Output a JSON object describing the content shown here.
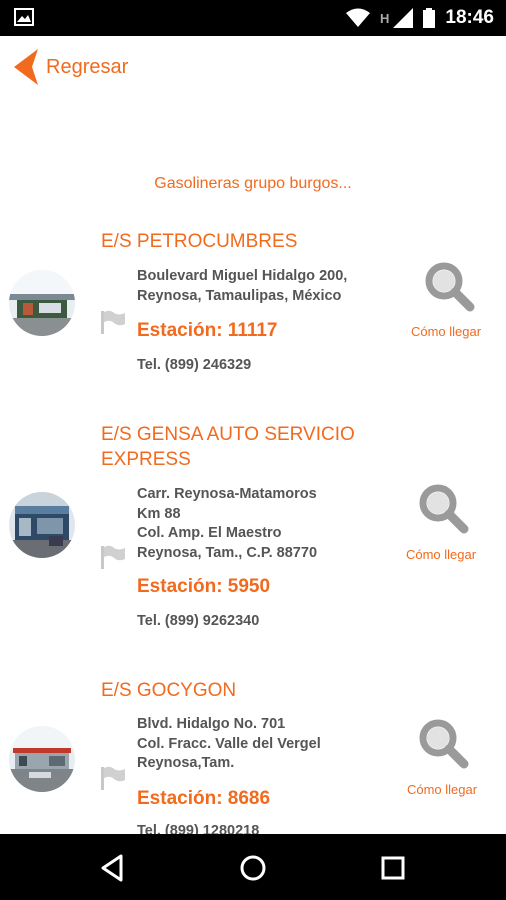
{
  "status_bar": {
    "time": "18:46",
    "network_letter": "H",
    "icons": [
      "photo-icon",
      "wifi-icon",
      "signal-icon",
      "battery-icon"
    ]
  },
  "header": {
    "back_label": "Regresar"
  },
  "subtitle": "Gasolineras grupo burgos...",
  "stations": [
    {
      "name": "E/S PETROCUMBRES",
      "address_lines": [
        "Boulevard Miguel Hidalgo 200,",
        "Reynosa, Tamaulipas, México"
      ],
      "station_label": "Estación: 11117",
      "tel": "Tel. (899) 246329",
      "directions_label": "Cómo llegar"
    },
    {
      "name": "E/S GENSA AUTO SERVICIO EXPRESS",
      "address_lines": [
        "Carr. Reynosa-Matamoros",
        "Km 88",
        "Col. Amp. El Maestro",
        "Reynosa, Tam., C.P. 88770"
      ],
      "station_label": "Estación: 5950",
      "tel": "Tel. (899) 9262340",
      "directions_label": "Cómo llegar"
    },
    {
      "name": "E/S GOCYGON",
      "address_lines": [
        "Blvd. Hidalgo No. 701",
        "Col. Fracc. Valle del Vergel",
        "Reynosa,Tam."
      ],
      "station_label": "Estación: 8686",
      "tel": "Tel. (899) 1280218",
      "directions_label": "Cómo llegar"
    }
  ],
  "colors": {
    "accent": "#f26a1d",
    "text_gray": "#555555",
    "icon_gray": "#9a9a9a"
  }
}
